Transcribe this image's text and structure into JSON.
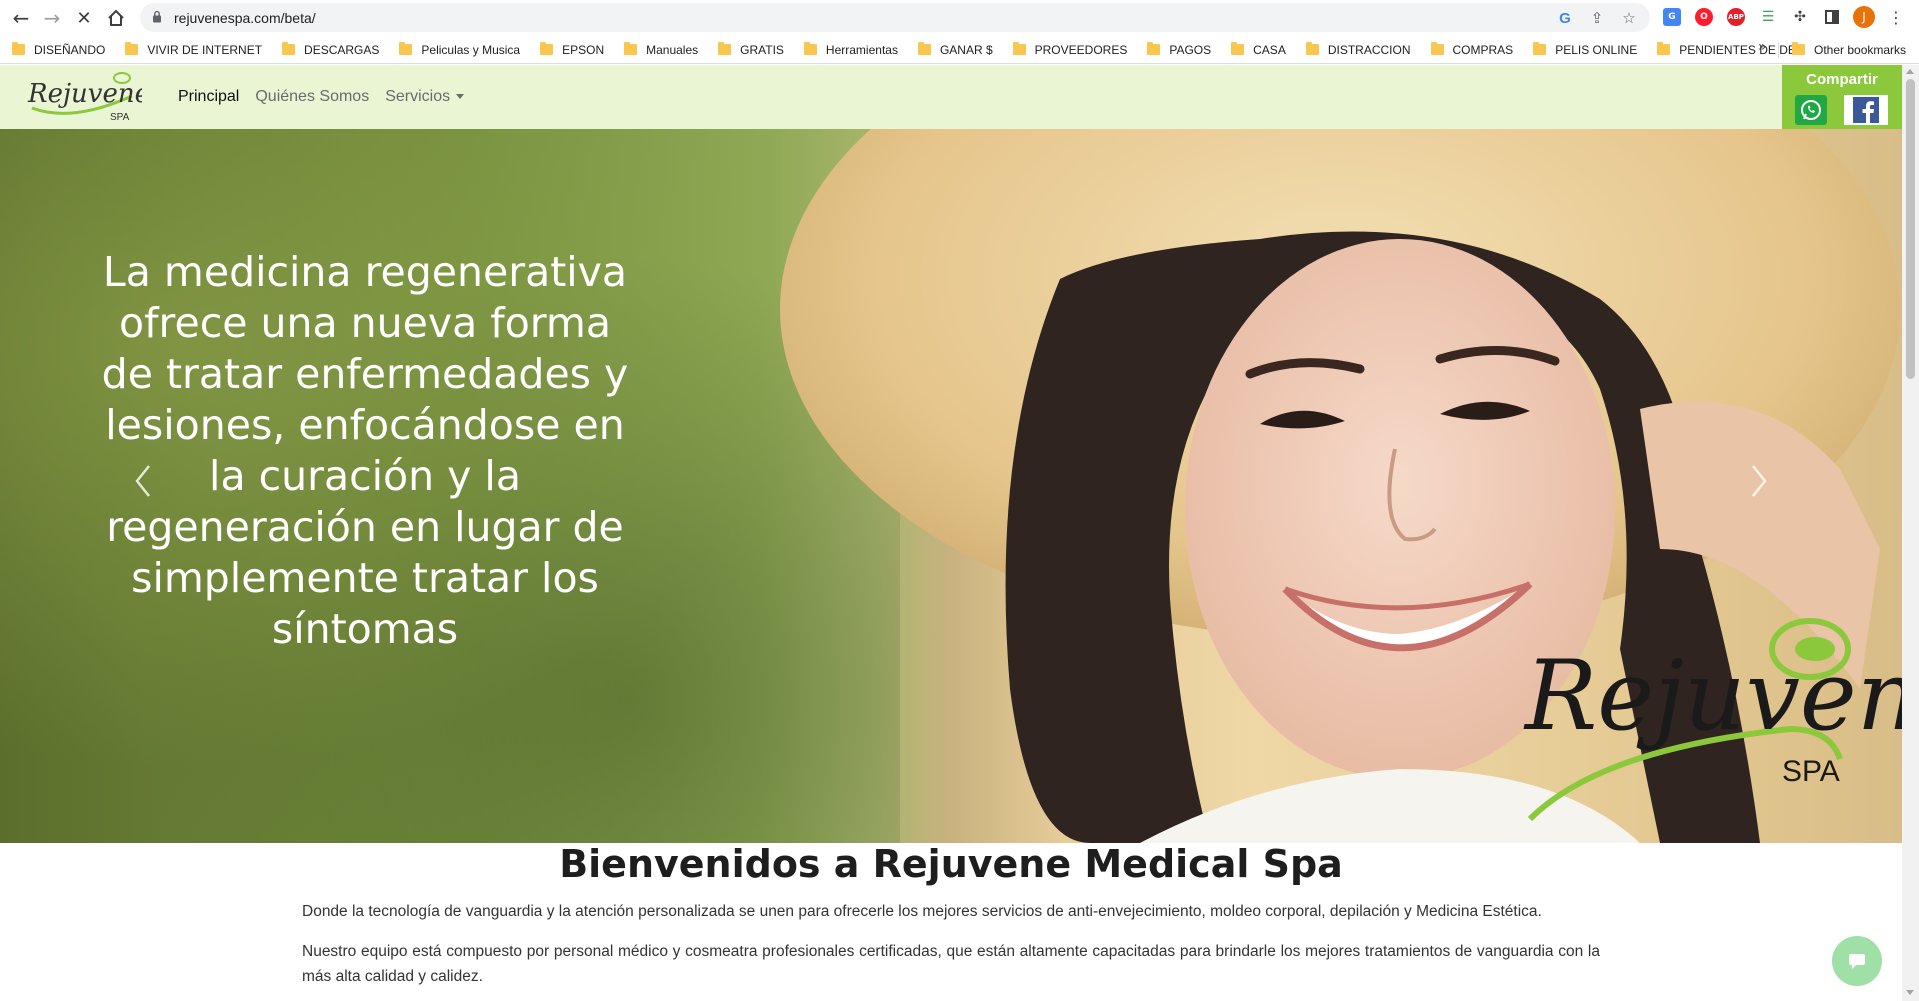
{
  "browser": {
    "url": "rejuvenespa.com/beta/",
    "profile_initial": "J",
    "bookmarks": [
      "DISEÑANDO",
      "VIVIR DE INTERNET",
      "DESCARGAS",
      "Peliculas y Musica",
      "EPSON",
      "Manuales",
      "GRATIS",
      "Herramientas",
      "GANAR $",
      "PROVEEDORES",
      "PAGOS",
      "CASA",
      "DISTRACCION",
      "COMPRAS",
      "PELIS ONLINE",
      "PENDIENTES DE DE..."
    ],
    "other_bookmarks": "Other bookmarks",
    "extensions": [
      "google-translate-icon",
      "opera-icon",
      "adblock-plus-icon",
      "equalizer-icon",
      "puzzle-extensions-icon",
      "side-panel-icon"
    ]
  },
  "site": {
    "logo_text": "Rejuvene",
    "logo_sub": "SPA",
    "nav": {
      "principal": "Principal",
      "quienes": "Quiénes Somos",
      "servicios": "Servicios"
    },
    "share_title": "Compartir"
  },
  "hero": {
    "text": "La medicina regenerativa ofrece una nueva forma de tratar enfermedades y lesiones, enfocándose en la curación y la regeneración en lugar de simplemente tratar los síntomas",
    "logo_text": "Rejuvene",
    "logo_sub": "SPA"
  },
  "welcome": {
    "title": "Bienvenidos a Rejuvene Medical Spa",
    "p1": "Donde la tecnología de vanguardia y la atención personalizada se unen para ofrecerle los mejores servicios de anti-envejecimiento, moldeo corporal, depilación y Medicina Estética.",
    "p2": "Nuestro equipo está compuesto por personal médico y cosmeatra profesionales certificadas, que están altamente capacitadas para brindarle los mejores tratamientos de vanguardia con la más alta calidad y calidez."
  },
  "colors": {
    "nav_bg": "#eaf5d3",
    "brand_green": "#8cc83c",
    "whatsapp": "#1fa844",
    "facebook": "#3b5998"
  }
}
